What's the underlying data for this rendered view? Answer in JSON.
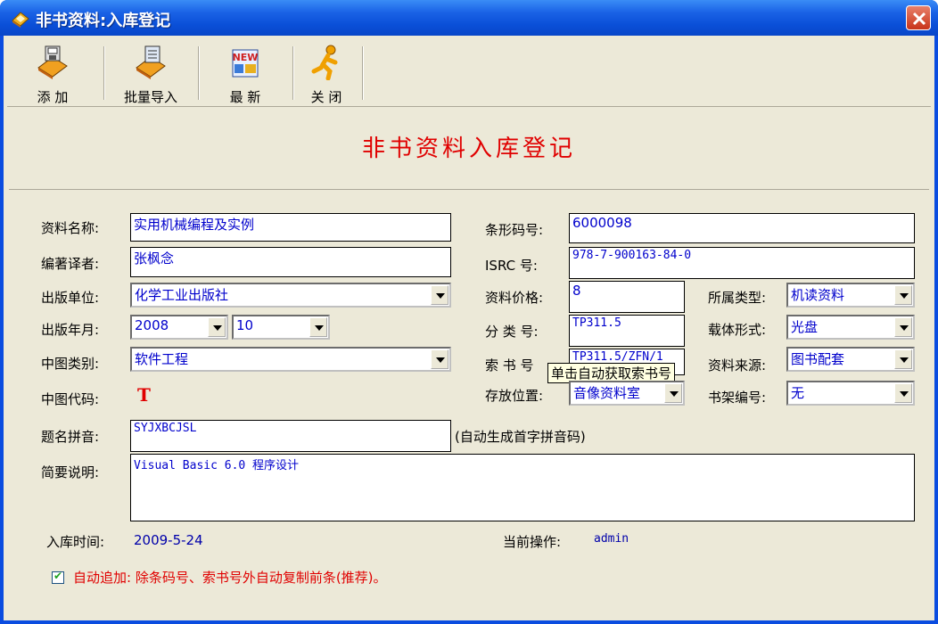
{
  "window": {
    "title": "非书资料:入库登记"
  },
  "toolbar": {
    "add": "添  加",
    "batch_import": "批量导入",
    "refresh": "最  新",
    "close": "关  闭"
  },
  "page_title": "非书资料入库登记",
  "form": {
    "name_label": "资料名称:",
    "name_value": "实用机械编程及实例",
    "author_label": "编著译者:",
    "author_value": "张枫念",
    "publisher_label": "出版单位:",
    "publisher_value": "化学工业出版社",
    "pubdate_label": "出版年月:",
    "pub_year": "2008",
    "pub_month": "10",
    "zt_category_label": "中图类别:",
    "zt_category_value": "软件工程",
    "zt_code_label": "中图代码:",
    "zt_code_value": "T",
    "pinyin_label": "题名拼音:",
    "pinyin_value": "SYJXBCJSL",
    "pinyin_hint": "(自动生成首字拼音码)",
    "summary_label": "简要说明:",
    "summary_value": "Visual Basic 6.0 程序设计",
    "barcode_label": "条形码号:",
    "barcode_value": "6000098",
    "isrc_label": "ISRC 号:",
    "isrc_value": "978-7-900163-84-0",
    "price_label": "资料价格:",
    "price_value": "8",
    "class_no_label": "分 类 号:",
    "class_no_value": "TP311.5",
    "call_no_label": "索 书 号",
    "call_no_value": "TP311.5/ZFN/1",
    "call_no_tooltip": "单击自动获取索书号",
    "location_label": "存放位置:",
    "location_value": "音像资料室",
    "type_label": "所属类型:",
    "type_value": "机读资料",
    "carrier_label": "载体形式:",
    "carrier_value": "光盘",
    "source_label": "资料来源:",
    "source_value": "图书配套",
    "shelf_label": "书架编号:",
    "shelf_value": "无",
    "intime_label": "入库时间:",
    "intime_value": "2009-5-24",
    "operator_label": "当前操作:",
    "operator_value": "admin",
    "auto_append_label": "自动追加: 除条码号、索书号外自动复制前条(推荐)。"
  },
  "colors": {
    "title_red": "#e00000",
    "value_blue": "#0000cc",
    "panel_bg": "#ece9d8",
    "titlebar_blue": "#0a4fd8"
  }
}
